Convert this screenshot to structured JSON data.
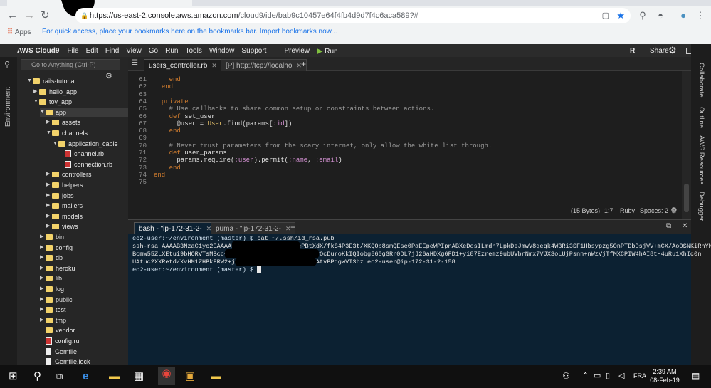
{
  "browser": {
    "url_host": "https://us-east-2.console.aws.amazon.com",
    "url_path": "/cloud9/ide/bab9c10457e64f4fb4d9d7f4c6aca589?#",
    "apps_label": "Apps",
    "bookmarks_hint": "For quick access, place your bookmarks here on the bookmarks bar. Import bookmarks now..."
  },
  "menubar": {
    "brand": "AWS Cloud9",
    "items": [
      "File",
      "Edit",
      "Find",
      "View",
      "Go",
      "Run",
      "Tools",
      "Window",
      "Support"
    ],
    "preview": "Preview",
    "run": "Run",
    "user_initial": "R",
    "share": "Share"
  },
  "sidebar": {
    "label": "Environment",
    "goto_placeholder": "Go to Anything (Ctrl-P)",
    "tree": [
      {
        "label": "rails-tutorial",
        "type": "folder",
        "open": true,
        "depth": 0
      },
      {
        "label": "hello_app",
        "type": "folder",
        "open": false,
        "depth": 1
      },
      {
        "label": "toy_app",
        "type": "folder",
        "open": true,
        "depth": 1
      },
      {
        "label": "app",
        "type": "folder",
        "open": true,
        "depth": 2
      },
      {
        "label": "assets",
        "type": "folder",
        "open": false,
        "depth": 3
      },
      {
        "label": "channels",
        "type": "folder",
        "open": true,
        "depth": 3
      },
      {
        "label": "application_cable",
        "type": "folder",
        "open": true,
        "depth": 4
      },
      {
        "label": "channel.rb",
        "type": "ruby",
        "depth": 5
      },
      {
        "label": "connection.rb",
        "type": "ruby",
        "depth": 5
      },
      {
        "label": "controllers",
        "type": "folder",
        "open": false,
        "depth": 3
      },
      {
        "label": "helpers",
        "type": "folder",
        "open": false,
        "depth": 3
      },
      {
        "label": "jobs",
        "type": "folder",
        "open": false,
        "depth": 3
      },
      {
        "label": "mailers",
        "type": "folder",
        "open": false,
        "depth": 3
      },
      {
        "label": "models",
        "type": "folder",
        "open": false,
        "depth": 3
      },
      {
        "label": "views",
        "type": "folder",
        "open": false,
        "depth": 3
      },
      {
        "label": "bin",
        "type": "folder",
        "open": false,
        "depth": 2
      },
      {
        "label": "config",
        "type": "folder",
        "open": false,
        "depth": 2
      },
      {
        "label": "db",
        "type": "folder",
        "open": false,
        "depth": 2
      },
      {
        "label": "heroku",
        "type": "folder",
        "open": false,
        "depth": 2
      },
      {
        "label": "lib",
        "type": "folder",
        "open": false,
        "depth": 2
      },
      {
        "label": "log",
        "type": "folder",
        "open": false,
        "depth": 2
      },
      {
        "label": "public",
        "type": "folder",
        "open": false,
        "depth": 2
      },
      {
        "label": "test",
        "type": "folder",
        "open": false,
        "depth": 2
      },
      {
        "label": "tmp",
        "type": "folder",
        "open": false,
        "depth": 2
      },
      {
        "label": "vendor",
        "type": "folder",
        "open": false,
        "depth": 2,
        "noarrow": true
      },
      {
        "label": "config.ru",
        "type": "ruby",
        "depth": 2
      },
      {
        "label": "Gemfile",
        "type": "file",
        "depth": 2
      },
      {
        "label": "Gemfile.lock",
        "type": "file",
        "depth": 2
      }
    ]
  },
  "editor_tabs": [
    {
      "label": "users_controller.rb",
      "active": true
    },
    {
      "label": "[P] http://tcp://localho",
      "active": false
    }
  ],
  "code": [
    {
      "n": "61",
      "html": "    <span class=\"kw\">end</span>"
    },
    {
      "n": "62",
      "html": "  <span class=\"kw\">end</span>"
    },
    {
      "n": "63",
      "html": ""
    },
    {
      "n": "64",
      "html": "  <span class=\"kw\">private</span>"
    },
    {
      "n": "65",
      "html": "    <span class=\"cm\"># Use callbacks to share common setup or constraints between actions.</span>"
    },
    {
      "n": "66",
      "html": "    <span class=\"kw\">def</span> set_user"
    },
    {
      "n": "67",
      "html": "      @user = <span class=\"cn\">User</span>.find(params[<span class=\"sy\">:id</span>])"
    },
    {
      "n": "68",
      "html": "    <span class=\"kw\">end</span>"
    },
    {
      "n": "69",
      "html": ""
    },
    {
      "n": "70",
      "html": "    <span class=\"cm\"># Never trust parameters from the scary internet, only allow the white list through.</span>"
    },
    {
      "n": "71",
      "html": "    <span class=\"kw\">def</span> user_params"
    },
    {
      "n": "72",
      "html": "      params.require(<span class=\"sy\">:user</span>).permit(<span class=\"sy\">:name</span>, <span class=\"sy\">:email</span>)"
    },
    {
      "n": "73",
      "html": "    <span class=\"kw\">end</span>"
    },
    {
      "n": "74",
      "html": "<span class=\"kw\">end</span>"
    },
    {
      "n": "75",
      "html": ""
    }
  ],
  "status": {
    "bytes": "(15 Bytes)",
    "position": "1:7",
    "language": "Ruby",
    "spaces": "Spaces: 2"
  },
  "right_panels": [
    "Collaborate",
    "Outline",
    "AWS Resources",
    "Debugger"
  ],
  "terminal_tabs": [
    {
      "label": "bash - \"ip-172-31-2-",
      "active": true
    },
    {
      "label": "puma - \"ip-172-31-2-",
      "active": false
    }
  ],
  "terminal": {
    "prompt1": "ec2-user:~/environment (master) $ ",
    "cmd1": "cat ~/.ssh/id_rsa.pub",
    "l1": "ssh-rsa AAAAB3NzaC1yc2EAAAADAQABAAABAQCkXbx4zePBtXdX/fkS4P3E3t/XKQOb8smQEse0PaEEpeWPIpnABXeDosILmdn7LpkDeJmwV8qeqk4W3Ri3SF1Hbsypzg5OnPTDbDsjVV+mCX/AoOSNKiRnYM",
    "l2": "Bcmw55ZLXEtui9bHORVTsMBcc+vkv8cFo2tfo8rn3mBQ3xZSujvOcDuroKkIQIobg560gGRr0DL7jJ26aHDXg6FD1+yi87Ezremz9ubUVbrNmx7VJXSoLUjPsnn+nWzVjTfMXCPIW4hAI8tH4uRu1XhIc0n",
    "l3": "UAtuc2XXRetd/XvHM1ZHBkFRW2+jZjkQiMfRkX4Sd6I1FxvuM8AtvBPqgwVI3hz ec2-user@ip-172-31-2-158",
    "prompt2": "ec2-user:~/environment (master) $ "
  },
  "taskbar": {
    "lang": "FRA",
    "time": "2:39 AM",
    "date": "08-Feb-19"
  }
}
